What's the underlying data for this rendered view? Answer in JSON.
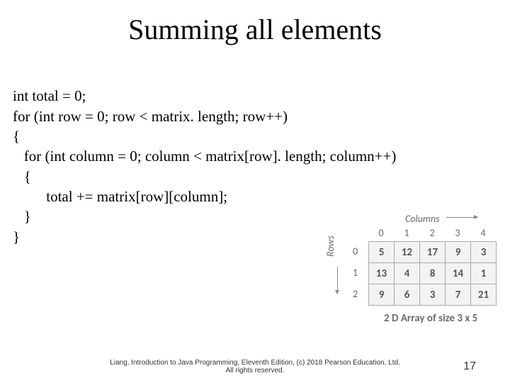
{
  "title": "Summing all elements",
  "code": {
    "l1": "int total = 0;",
    "l2": "for (int row = 0; row < matrix. length; row++)",
    "l3": "{",
    "l4": "   for (int column = 0; column < matrix[row]. length; column++)",
    "l5": "   {",
    "l6": "         total += matrix[row][column];",
    "l7": "   }",
    "l8": "}"
  },
  "array": {
    "columns_label": "Columns",
    "rows_label": "Rows",
    "col_headers": [
      "0",
      "1",
      "2",
      "3",
      "4"
    ],
    "row_headers": [
      "0",
      "1",
      "2"
    ],
    "cells": [
      [
        "5",
        "12",
        "17",
        "9",
        "3"
      ],
      [
        "13",
        "4",
        "8",
        "14",
        "1"
      ],
      [
        "9",
        "6",
        "3",
        "7",
        "21"
      ]
    ],
    "caption": "2 D Array of size 3 x 5"
  },
  "footer": {
    "line1": "Liang, Introduction to Java Programming, Eleventh Edition, (c) 2018 Pearson Education, Ltd.",
    "line2": "All rights reserved."
  },
  "page_number": "17"
}
